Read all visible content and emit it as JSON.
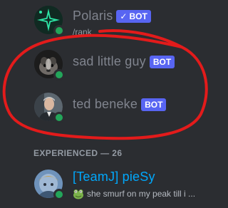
{
  "members": [
    {
      "name": "Polaris",
      "bot_tag": "BOT",
      "verified": true,
      "subtext": "/rank",
      "status": "online"
    },
    {
      "name": "sad little guy",
      "bot_tag": "BOT",
      "status": "online"
    },
    {
      "name": "ted beneke",
      "bot_tag": "BOT",
      "status": "online"
    }
  ],
  "section": {
    "title": "EXPERIENCED — 26"
  },
  "featured_member": {
    "name": "[TeamJ] pieSy",
    "custom_status": "she smurf on my peak till i ...",
    "status": "online"
  },
  "colors": {
    "panel_bg": "#2b2d31",
    "bot_tag": "#5865f2",
    "online": "#23a55a",
    "role_name": "#00a8fc",
    "annotation": "#e31b1b"
  }
}
